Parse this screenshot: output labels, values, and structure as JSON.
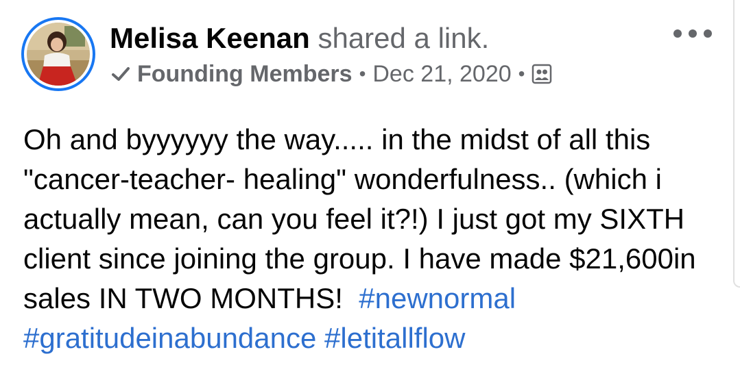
{
  "post": {
    "author_name": "Melisa Keenan",
    "action_text": "shared a link.",
    "group_name": "Founding Members",
    "separator": "•",
    "date": "Dec 21, 2020",
    "body_text": "Oh and byyyyyy the way..... in the midst of all this \"cancer-teacher- healing\" wonderfulness.. (which i actually mean, can you feel it?!) I just got my SIXTH client since joining the group. I have made $21,600in sales IN TWO MONTHS!",
    "hashtags": [
      "#newnormal",
      "#gratitudeinabundance",
      "#letitallflow"
    ]
  },
  "icons": {
    "group_icon": "checkmark-badge-icon",
    "audience_icon": "group-members-icon",
    "more_icon": "more-options-icon"
  },
  "colors": {
    "accent": "#1877f2",
    "hashtag": "#2d6fcf",
    "secondary_text": "#65676b",
    "primary_text": "#050505"
  }
}
